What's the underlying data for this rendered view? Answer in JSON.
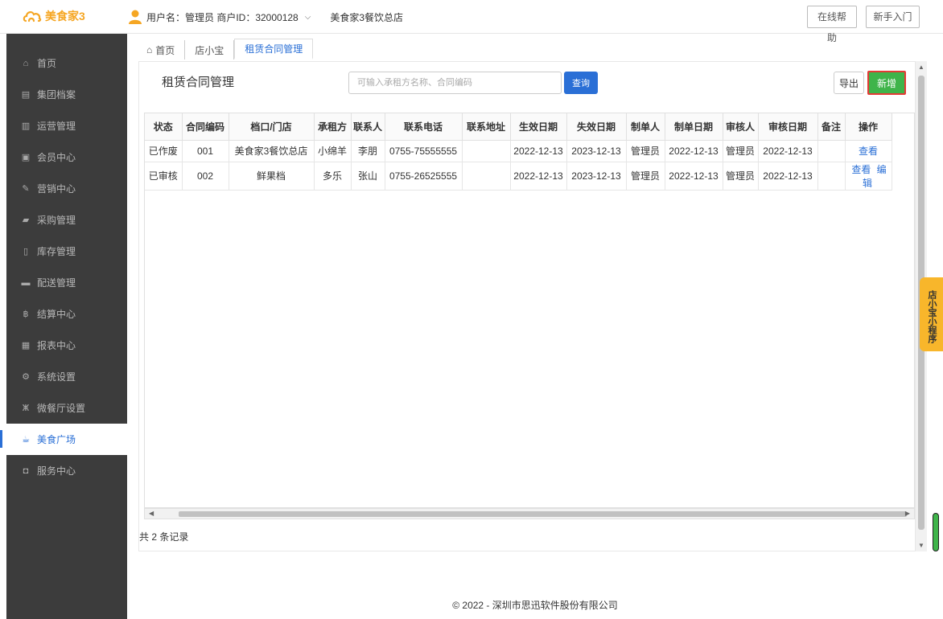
{
  "topbar": {
    "brand": "美食家3",
    "user_text": "用户名：管理员  商户ID：32000128",
    "store": "美食家3餐饮总店",
    "help_label": "在线帮助",
    "guide_label": "新手入门"
  },
  "sidebar": {
    "items": [
      {
        "label": "首页",
        "icon": "home-icon"
      },
      {
        "label": "集团档案",
        "icon": "file-icon"
      },
      {
        "label": "运营管理",
        "icon": "bar-chart-icon"
      },
      {
        "label": "会员中心",
        "icon": "member-card-icon"
      },
      {
        "label": "营销中心",
        "icon": "edit-icon"
      },
      {
        "label": "采购管理",
        "icon": "purchase-icon"
      },
      {
        "label": "库存管理",
        "icon": "inventory-icon"
      },
      {
        "label": "配送管理",
        "icon": "truck-icon"
      },
      {
        "label": "结算中心",
        "icon": "baht-icon"
      },
      {
        "label": "报表中心",
        "icon": "report-icon"
      },
      {
        "label": "系统设置",
        "icon": "gears-icon"
      },
      {
        "label": "微餐厅设置",
        "icon": "cutlery-icon"
      },
      {
        "label": "美食广场",
        "icon": "coffee-icon",
        "active": true
      },
      {
        "label": "服务中心",
        "icon": "service-icon"
      }
    ]
  },
  "tabs": [
    {
      "label": "首页",
      "icon": "home-icon"
    },
    {
      "label": "店小宝"
    },
    {
      "label": "租赁合同管理",
      "active": true
    }
  ],
  "main": {
    "title": "租赁合同管理",
    "search_placeholder": "可输入承租方名称、合同编码",
    "search_label": "查询",
    "export_label": "导出",
    "add_label": "新增",
    "columns": [
      "状态",
      "合同编码",
      "档口/门店",
      "承租方",
      "联系人",
      "联系电话",
      "联系地址",
      "生效日期",
      "失效日期",
      "制单人",
      "制单日期",
      "审核人",
      "审核日期",
      "备注",
      "操作"
    ],
    "rows": [
      {
        "cells": [
          "已作废",
          "001",
          "美食家3餐饮总店",
          "小绵羊",
          "李朋",
          "0755-75555555",
          "",
          "2022-12-13",
          "2023-12-13",
          "管理员",
          "2022-12-13",
          "管理员",
          "2022-12-13",
          ""
        ],
        "actions": [
          "查看"
        ]
      },
      {
        "cells": [
          "已审核",
          "002",
          "鲜果档",
          "多乐",
          "张山",
          "0755-26525555",
          "",
          "2022-12-13",
          "2023-12-13",
          "管理员",
          "2022-12-13",
          "管理员",
          "2022-12-13",
          ""
        ],
        "actions": [
          "查看",
          "编辑"
        ]
      }
    ],
    "records": "共 2 条记录"
  },
  "side_tab": "店小宝小程序",
  "footer": "© 2022 - 深圳市思迅软件股份有限公司",
  "colors": {
    "accent": "#2a6fd6",
    "add": "#3fb44a",
    "add_border": "#e53935",
    "sidebar": "#3c3c3c",
    "side_tab": "#f8b62b"
  }
}
